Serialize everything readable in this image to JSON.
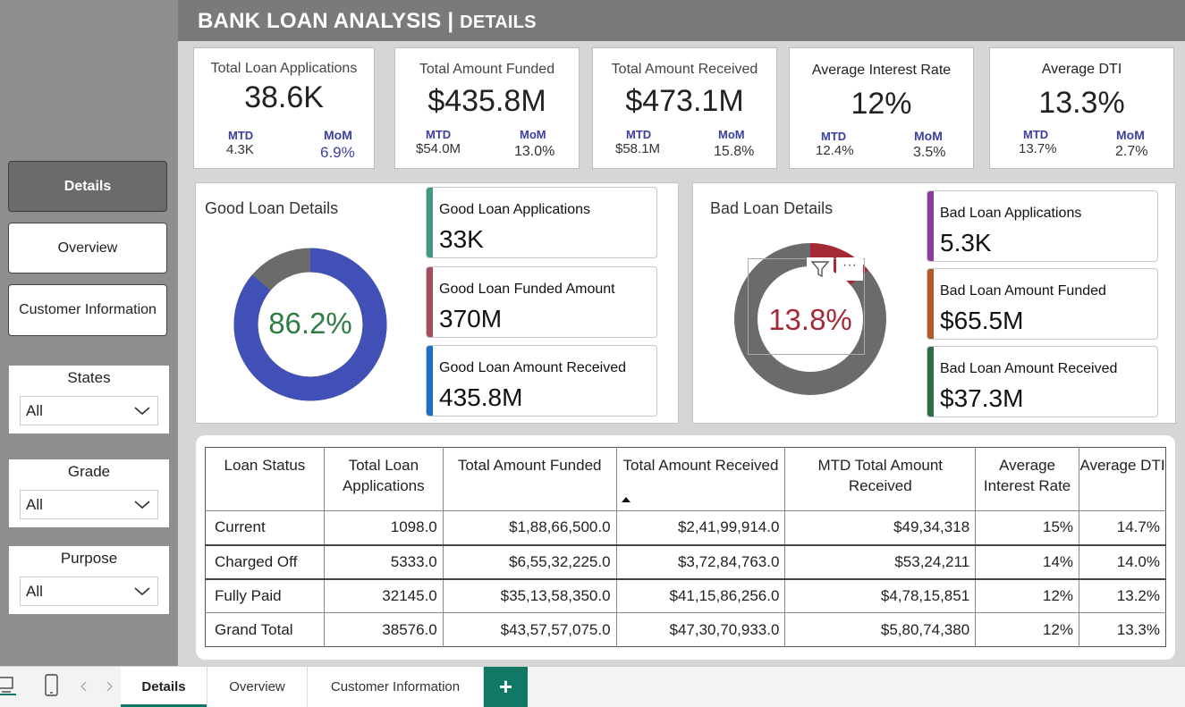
{
  "header": {
    "title_main": "BANK LOAN ANALYSIS",
    "title_sep": " | ",
    "title_sub": "DETAILS"
  },
  "nav": [
    {
      "label": "Details",
      "active": true
    },
    {
      "label": "Overview",
      "active": false
    },
    {
      "label": "Customer Information",
      "active": false
    }
  ],
  "slicers": [
    {
      "label": "States",
      "value": "All"
    },
    {
      "label": "Grade",
      "value": "All"
    },
    {
      "label": "Purpose",
      "value": "All"
    }
  ],
  "kpis": [
    {
      "title": "Total Loan Applications",
      "value": "38.6K",
      "mtd_label": "MTD",
      "mtd": "4.3K",
      "mom_label": "MoM",
      "mom": "6.9%"
    },
    {
      "title": "Total Amount Funded",
      "value": "$435.8M",
      "mtd_label": "MTD",
      "mtd": "$54.0M",
      "mom_label": "MoM",
      "mom": "13.0%"
    },
    {
      "title": "Total Amount Received",
      "value": "$473.1M",
      "mtd_label": "MTD",
      "mtd": "$58.1M",
      "mom_label": "MoM",
      "mom": "15.8%"
    },
    {
      "title": "Average Interest Rate",
      "value": "12%",
      "mtd_label": "MTD",
      "mtd": "12.4%",
      "mom_label": "MoM",
      "mom": "3.5%"
    },
    {
      "title": "Average DTI",
      "value": "13.3%",
      "mtd_label": "MTD",
      "mtd": "13.7%",
      "mom_label": "MoM",
      "mom": "2.7%"
    }
  ],
  "good": {
    "title": "Good Loan Details",
    "pct_label": "86.2%",
    "pct_value": 0.862,
    "ring_color": "#4150b6",
    "rest_color": "#6b6b6b",
    "label_color": "#2e7d44",
    "cards": [
      {
        "title": "Good Loan Applications",
        "value": "33K",
        "color": "#3e9a84"
      },
      {
        "title": "Good Loan Funded Amount",
        "value": "370M",
        "color": "#a3505e"
      },
      {
        "title": "Good Loan Amount Received",
        "value": "435.8M",
        "color": "#1e6fc4"
      }
    ]
  },
  "bad": {
    "title": "Bad Loan Details",
    "pct_label": "13.8%",
    "pct_value": 0.138,
    "ring_color": "#a52a36",
    "rest_color": "#6b6b6b",
    "label_color": "#a52a36",
    "cards": [
      {
        "title": "Bad Loan Applications",
        "value": "5.3K",
        "color": "#8a3d9e"
      },
      {
        "title": "Bad Loan Amount Funded",
        "value": "$65.5M",
        "color": "#b35a2a"
      },
      {
        "title": "Bad Loan Amount Received",
        "value": "$37.3M",
        "color": "#2f6b44"
      }
    ]
  },
  "table": {
    "headers": [
      "Loan Status",
      "Total Loan Applications",
      "Total Amount Funded",
      "Total Amount Received",
      "MTD Total Amount Received",
      "Average Interest Rate",
      "Average DTI"
    ],
    "rows": [
      [
        "Current",
        "1098.0",
        "$1,88,66,500.0",
        "$2,41,99,914.0",
        "$49,34,318",
        "15%",
        "14.7%"
      ],
      [
        "Charged Off",
        "5333.0",
        "$6,55,32,225.0",
        "$3,72,84,763.0",
        "$53,24,211",
        "14%",
        "14.0%"
      ],
      [
        "Fully Paid",
        "32145.0",
        "$35,13,58,350.0",
        "$41,15,86,256.0",
        "$4,78,15,851",
        "12%",
        "13.2%"
      ],
      [
        "Grand Total",
        "38576.0",
        "$43,57,57,075.0",
        "$47,30,70,933.0",
        "$5,80,74,380",
        "12%",
        "13.3%"
      ]
    ]
  },
  "tabs": [
    {
      "label": "Details",
      "active": true
    },
    {
      "label": "Overview",
      "active": false
    },
    {
      "label": "Customer Information",
      "active": false
    },
    {
      "label": "+",
      "active": false
    }
  ],
  "icons": {
    "desktop": "desktop-view-icon",
    "phone": "mobile-view-icon",
    "prev": "chevron-left-icon",
    "next": "chevron-right-icon",
    "filter": "filter-icon",
    "more": "more-options-icon"
  },
  "colors": {
    "accent": "#117865"
  }
}
